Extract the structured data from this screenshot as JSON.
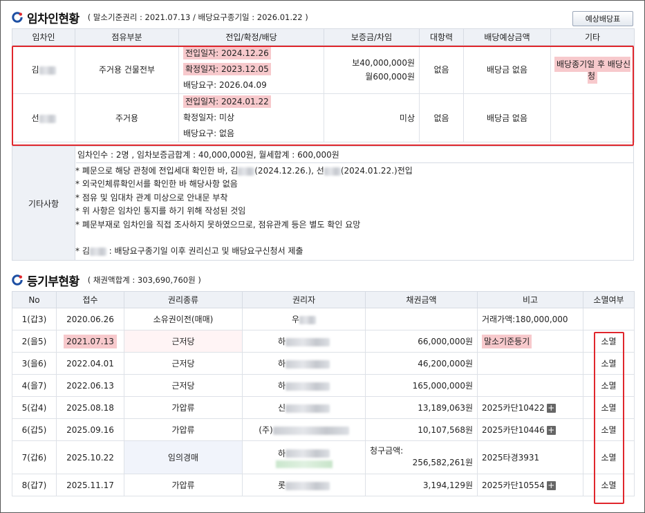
{
  "tenant_section": {
    "title": "임차인현황",
    "subtitle": "( 말소기준권리 : 2021.07.13 / 배당요구종기일 : 2026.01.22 )",
    "forecast_button": "예상배당표",
    "headers": [
      "임차인",
      "점유부분",
      "전입/확정/배당",
      "보증금/차임",
      "대항력",
      "배당예상금액",
      "기타"
    ],
    "rows": [
      {
        "name": "김",
        "occupancy": "주거용 건물전부",
        "move_in": "전입일자: 2024.12.26",
        "confirmed": "확정일자: 2023.12.05",
        "dividend": "배당요구: 2026.04.09",
        "deposit": "보40,000,000원",
        "rent": "월600,000원",
        "opposing": "없음",
        "expected": "배당금 없음",
        "etc": "배당종기일 후 배당신청"
      },
      {
        "name": "선",
        "occupancy": "주거용",
        "move_in": "전입일자: 2024.01.22",
        "confirmed": "확정일자: 미상",
        "dividend": "배당요구: 없음",
        "deposit": "미상",
        "rent": "",
        "opposing": "없음",
        "expected": "배당금 없음",
        "etc": ""
      }
    ],
    "notes": {
      "label": "기타사항",
      "summary": "임차인수 : 2명 , 임차보증금합계 : 40,000,000원, 월세합계 : 600,000원",
      "line1_a": " * 폐문으로 해당 관청에 전입세대 확인한 바, 김",
      "line1_b": "(2024.12.26.), 선",
      "line1_c": "(2024.01.22.)전입",
      "line2": "* 외국인체류확인서를 확인한 바 해당사항 없음",
      "line3": "* 점유 및 임대차 관계 미상으로 안내문 부착",
      "line4": "* 위 사항은 임차인 통지를 하기 위해 작성된 것임",
      "line5": "* 폐문부재로 임차인을 직접 조사하지 못하였으므로, 점유관계 등은 별도 확인 요망",
      "line7_a": "* 김",
      "line7_b": " : 배당요구종기일 이후 권리신고 및 배당요구신청서 제출"
    }
  },
  "registry_section": {
    "title": "등기부현황",
    "subtitle": "( 채권액합계 : 303,690,760원 )",
    "headers": [
      "No",
      "접수",
      "권리종류",
      "권리자",
      "채권금액",
      "비고",
      "소멸여부"
    ],
    "rows": [
      {
        "no": "1(갑3)",
        "date": "2020.06.26",
        "type": "소유권이전(매매)",
        "holder": "우",
        "amount": "",
        "note": "거래가액:180,000,000",
        "status": ""
      },
      {
        "no": "2(을5)",
        "date": "2021.07.13",
        "type": "근저당",
        "holder": "하",
        "amount": "66,000,000원",
        "note": "말소기준등기",
        "status": "소멸"
      },
      {
        "no": "3(을6)",
        "date": "2022.04.01",
        "type": "근저당",
        "holder": "하",
        "amount": "46,200,000원",
        "note": "",
        "status": "소멸"
      },
      {
        "no": "4(을7)",
        "date": "2022.06.13",
        "type": "근저당",
        "holder": "하",
        "amount": "165,000,000원",
        "note": "",
        "status": "소멸"
      },
      {
        "no": "5(갑4)",
        "date": "2025.08.18",
        "type": "가압류",
        "holder": "신",
        "amount": "13,189,063원",
        "note": "2025카단10422",
        "status": "소멸"
      },
      {
        "no": "6(갑5)",
        "date": "2025.09.16",
        "type": "가압류",
        "holder": "(주)",
        "amount": "10,107,568원",
        "note": "2025카단10446",
        "status": "소멸"
      },
      {
        "no": "7(갑6)",
        "date": "2025.10.22",
        "type": "임의경매",
        "holder": "하",
        "amount_label": "청구금액:",
        "amount": "256,582,261원",
        "note": "2025타경3931",
        "status": "소멸"
      },
      {
        "no": "8(갑7)",
        "date": "2025.11.17",
        "type": "가압류",
        "holder": "롯",
        "amount": "3,194,129원",
        "note": "2025카단10554",
        "status": "소멸"
      }
    ],
    "plus_symbol": "+"
  },
  "colors": {
    "highlight": "#f7c9cc",
    "red_box": "#e0262c",
    "header_bg": "#eef1f6"
  }
}
